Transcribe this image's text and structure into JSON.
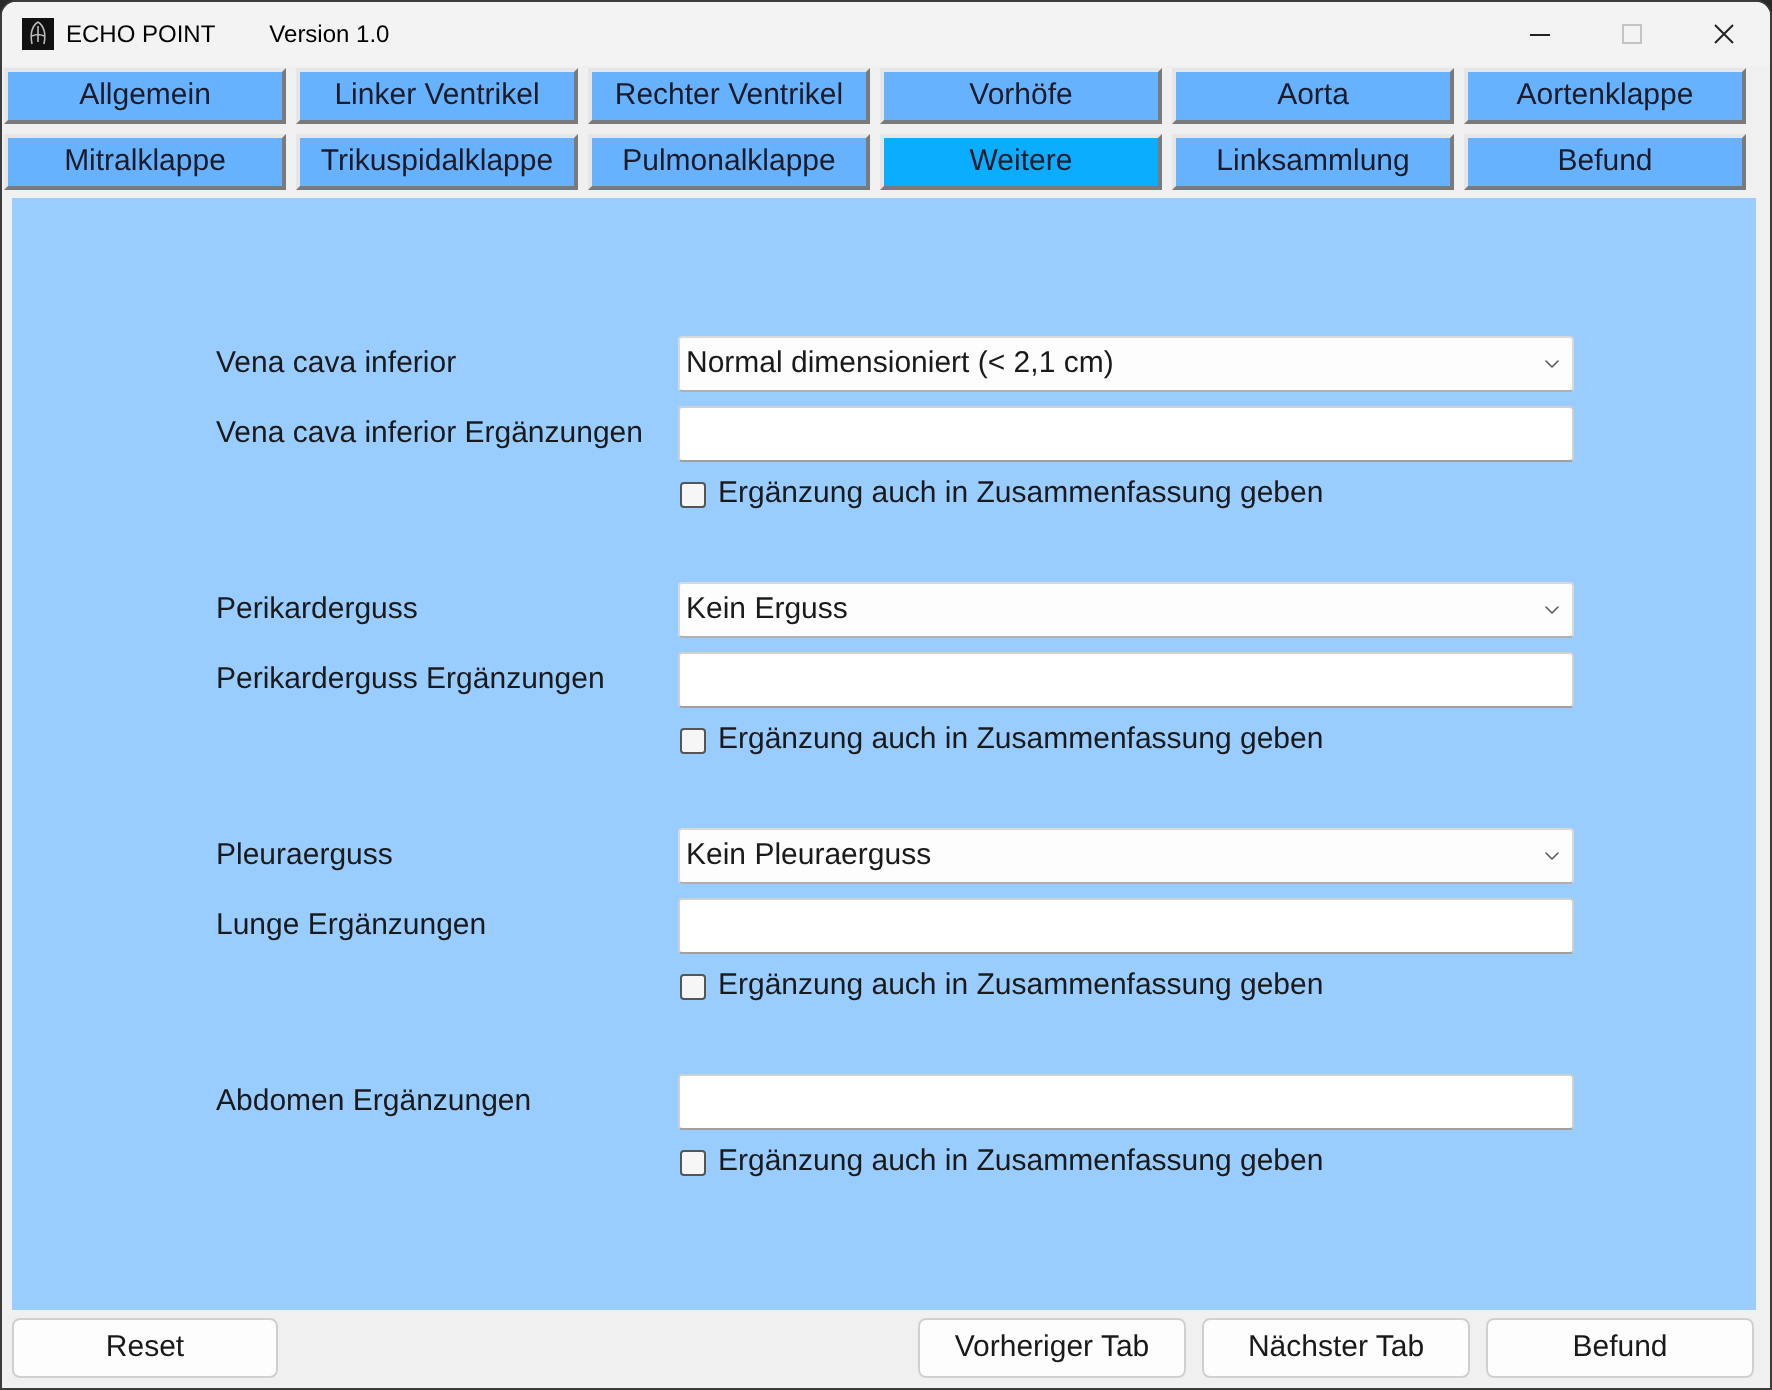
{
  "window": {
    "title": "ECHO POINT",
    "version": "Version 1.0"
  },
  "tabs": [
    {
      "label": "Allgemein",
      "selected": false
    },
    {
      "label": "Linker Ventrikel",
      "selected": false
    },
    {
      "label": "Rechter Ventrikel",
      "selected": false
    },
    {
      "label": "Vorhöfe",
      "selected": false
    },
    {
      "label": "Aorta",
      "selected": false
    },
    {
      "label": "Aortenklappe",
      "selected": false
    },
    {
      "label": "Mitralklappe",
      "selected": false
    },
    {
      "label": "Trikuspidalklappe",
      "selected": false
    },
    {
      "label": "Pulmonalklappe",
      "selected": false
    },
    {
      "label": "Weitere",
      "selected": true
    },
    {
      "label": "Linksammlung",
      "selected": false
    },
    {
      "label": "Befund",
      "selected": false
    }
  ],
  "form_groups": [
    {
      "fields": [
        {
          "kind": "select",
          "label": "Vena cava inferior",
          "value": "Normal dimensioniert (< 2,1 cm)"
        },
        {
          "kind": "text",
          "label": "Vena cava inferior Ergänzungen"
        },
        {
          "kind": "checkbox",
          "label": "Ergänzung auch in Zusammenfassung geben",
          "checked": false
        }
      ]
    },
    {
      "fields": [
        {
          "kind": "select",
          "label": "Perikarderguss",
          "value": "Kein Erguss"
        },
        {
          "kind": "text",
          "label": "Perikarderguss Ergänzungen"
        },
        {
          "kind": "checkbox",
          "label": "Ergänzung auch in Zusammenfassung geben",
          "checked": false
        }
      ]
    },
    {
      "fields": [
        {
          "kind": "select",
          "label": "Pleuraerguss",
          "value": "Kein Pleuraerguss"
        },
        {
          "kind": "text",
          "label": "Lunge Ergänzungen"
        },
        {
          "kind": "checkbox",
          "label": "Ergänzung auch in Zusammenfassung geben",
          "checked": false
        }
      ]
    },
    {
      "fields": [
        {
          "kind": "text",
          "label": "Abdomen Ergänzungen"
        },
        {
          "kind": "checkbox",
          "label": "Ergänzung auch in Zusammenfassung geben",
          "checked": false
        }
      ]
    }
  ],
  "footer": {
    "left_buttons": [
      {
        "label": "Reset"
      }
    ],
    "right_buttons": [
      {
        "label": "Vorheriger Tab"
      },
      {
        "label": "Nächster Tab"
      },
      {
        "label": "Befund"
      }
    ]
  }
}
